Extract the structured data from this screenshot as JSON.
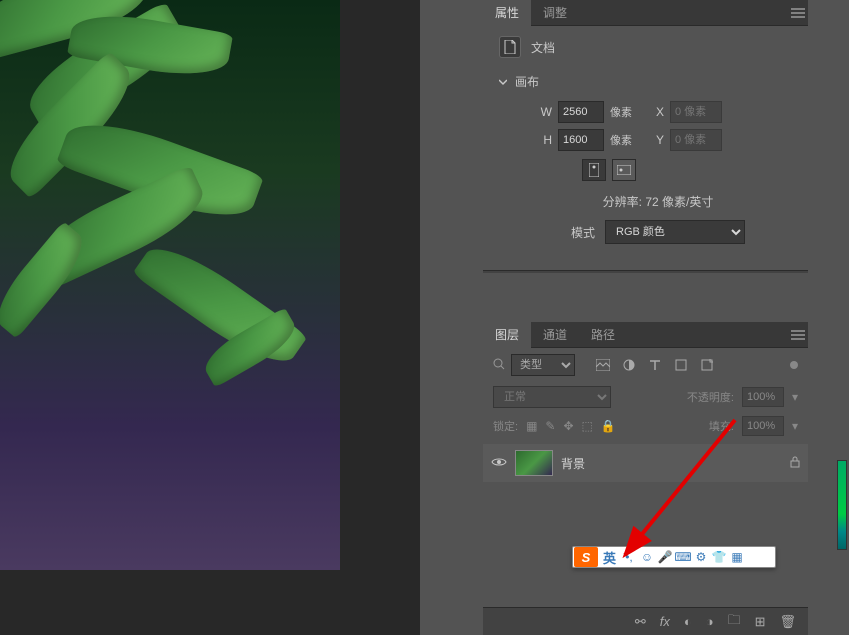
{
  "properties_panel": {
    "tabs": {
      "properties": "属性",
      "adjustments": "调整"
    },
    "doc_label": "文档",
    "canvas_section": {
      "title": "画布",
      "w_label": "W",
      "h_label": "H",
      "x_label": "X",
      "y_label": "Y",
      "width_value": "2560",
      "height_value": "1600",
      "unit": "像素",
      "x_placeholder": "0 像素",
      "y_placeholder": "0 像素",
      "resolution_label": "分辨率:",
      "resolution_value": "72 像素/英寸",
      "mode_label": "模式",
      "mode_value": "RGB 颜色"
    }
  },
  "layers_panel": {
    "tabs": {
      "layers": "图层",
      "channels": "通道",
      "paths": "路径"
    },
    "filter_type": "类型",
    "blend_mode": "正常",
    "opacity_label": "不透明度:",
    "opacity_value": "100%",
    "lock_label": "锁定:",
    "fill_label": "填充:",
    "fill_value": "100%",
    "layers": [
      {
        "name": "背景",
        "locked": true
      }
    ]
  },
  "ime": {
    "lang": "英",
    "punct": "•,"
  }
}
